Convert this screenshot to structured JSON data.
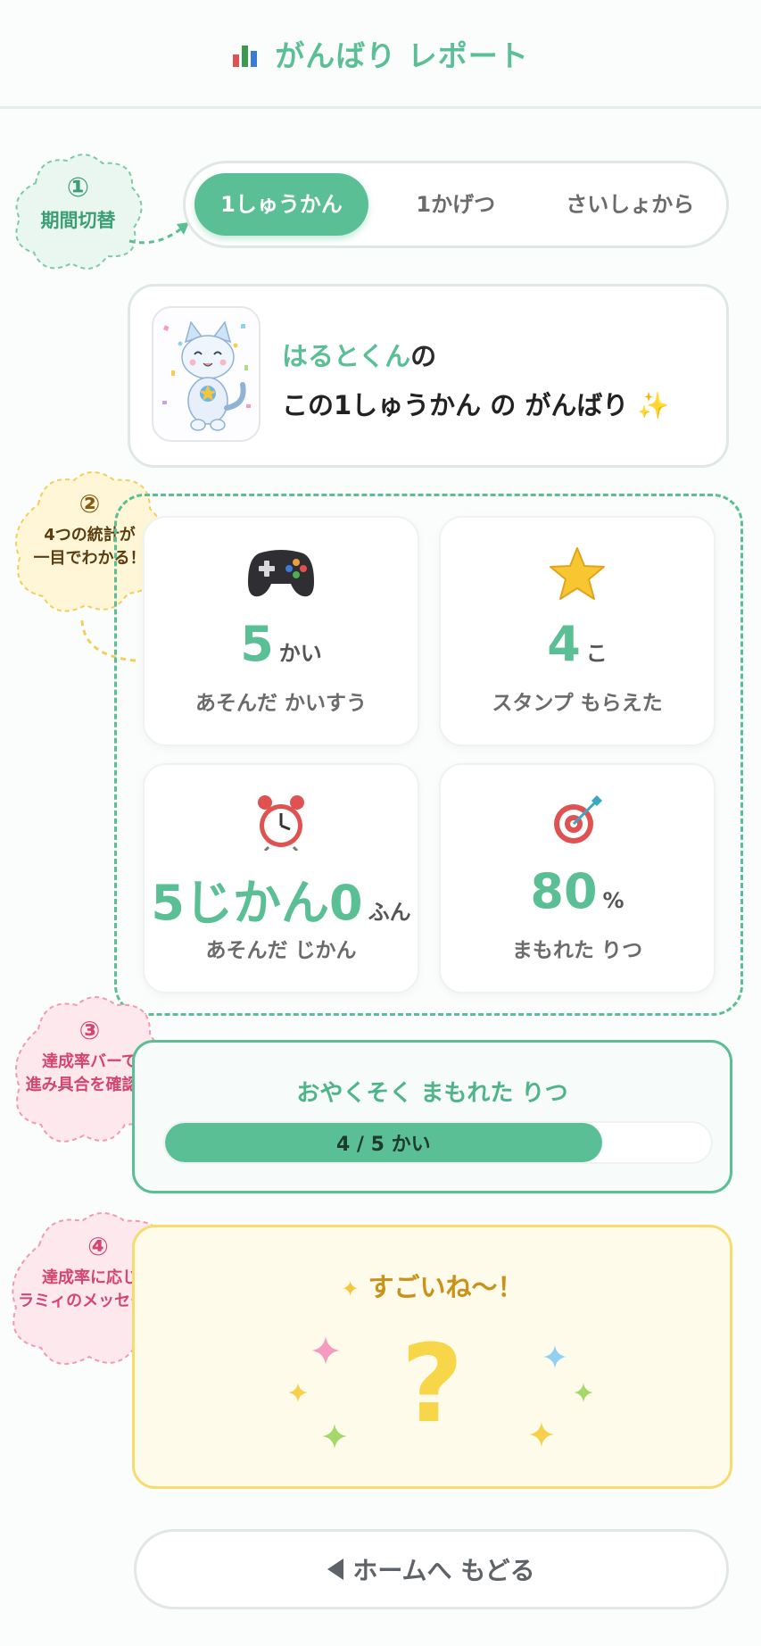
{
  "header": {
    "title": "がんばり レポート",
    "icon": "bar-chart-icon"
  },
  "tabs": [
    {
      "label": "1しゅうかん",
      "active": true
    },
    {
      "label": "1かげつ",
      "active": false
    },
    {
      "label": "さいしょから",
      "active": false
    }
  ],
  "profile": {
    "name": "はるとくん",
    "name_suffix": "の",
    "subtitle": "この1しゅうかん の がんばり",
    "subtitle_icon": "sparkle-icon",
    "avatar": "cat-mascot-avatar"
  },
  "stats": [
    {
      "icon": "game-controller-icon",
      "value": "5",
      "unit": "かい",
      "label": "あそんだ かいすう"
    },
    {
      "icon": "star-icon",
      "value": "4",
      "unit": "こ",
      "label": "スタンプ もらえた"
    },
    {
      "icon": "alarm-clock-icon",
      "value": "5じかん0",
      "unit": "ふん",
      "label": "あそんだ じかん"
    },
    {
      "icon": "target-icon",
      "value": "80",
      "unit": "%",
      "label": "まもれた りつ"
    }
  ],
  "progress": {
    "title": "おやくそく まもれた りつ",
    "text": "4 / 5 かい",
    "fraction": 0.8,
    "color": "#5bbf95"
  },
  "message": {
    "title": "すごいね〜！",
    "icon": "sparkle-star-icon",
    "placeholder": "?"
  },
  "home_button": {
    "label": "ホームへ もどる",
    "icon": "back-triangle-icon"
  },
  "annotations": [
    {
      "number": "①",
      "label": "期間切替",
      "color": "#eaf7f0",
      "border": "#7ccaa6",
      "text_color": "#3b9e74"
    },
    {
      "number": "②",
      "label": "4つの統計が\n一目でわかる！",
      "color": "#fff6d8",
      "border": "#f2cf5b",
      "text_color": "#5a3e10"
    },
    {
      "number": "③",
      "label": "達成率バーで\n進み具合を確認！",
      "color": "#fde8ee",
      "border": "#f19ab4",
      "text_color": "#d4456f"
    },
    {
      "number": "④",
      "label": "達成率に応じた\nラミィのメッセージ！",
      "color": "#fde8ee",
      "border": "#f19ab4",
      "text_color": "#d4456f"
    }
  ],
  "colors": {
    "accent": "#5bbf95",
    "yellow": "#f6dc6e",
    "pink": "#f19ab4"
  }
}
